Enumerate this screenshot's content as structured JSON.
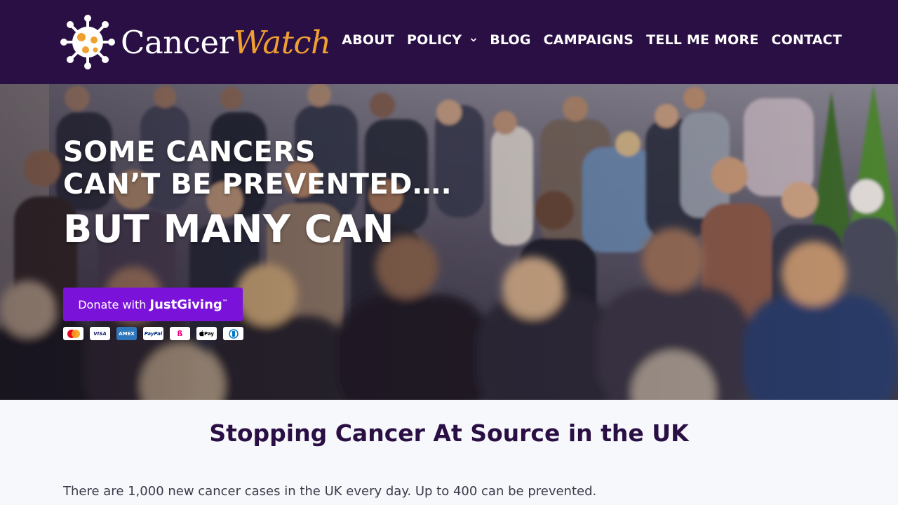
{
  "brand": {
    "name_part1": "Cancer",
    "name_part2": "Watch",
    "accent_color": "#f0a030",
    "header_color": "#2a0f45"
  },
  "nav": {
    "items": [
      {
        "label": "ABOUT"
      },
      {
        "label": "POLICY",
        "has_dropdown": true
      },
      {
        "label": "BLOG"
      },
      {
        "label": "CAMPAIGNS"
      },
      {
        "label": "TELL ME MORE"
      },
      {
        "label": "CONTACT"
      }
    ]
  },
  "hero": {
    "line1": "SOME CANCERS",
    "line2": "CAN’T BE PREVENTED….",
    "line3": "BUT MANY CAN",
    "donate_prefix": "Donate with",
    "donate_brand": "JustGiving",
    "donate_tm": "™",
    "donate_color": "#7b12d9",
    "payment_methods": [
      "mastercard-icon",
      "visa-icon",
      "amex-icon",
      "paypal-icon",
      "klarna-icon",
      "apple-pay-icon",
      "diners-icon"
    ],
    "payment_labels": {
      "visa": "VISA",
      "amex": "AMEX",
      "paypal": "PayPal",
      "applepay": "Pay"
    }
  },
  "main": {
    "title": "Stopping Cancer At Source in the UK",
    "intro": "There are 1,000 new cancer cases in the UK every day. Up to 400 can be prevented."
  }
}
